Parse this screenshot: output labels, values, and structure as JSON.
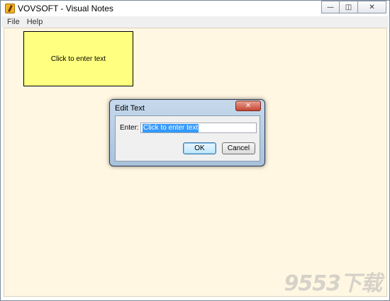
{
  "window": {
    "title": "VOVSOFT - Visual Notes",
    "controls": {
      "minimize": "—",
      "restore": "◫",
      "close": "✕"
    }
  },
  "menu": {
    "items": [
      "File",
      "Help"
    ]
  },
  "note": {
    "text": "Click to enter text",
    "color": "#ffff80"
  },
  "dialog": {
    "title": "Edit Text",
    "close_glyph": "✕",
    "field_label": "Enter:",
    "field_value": "Click to enter text",
    "ok_label": "OK",
    "cancel_label": "Cancel"
  },
  "watermark": {
    "text": "9553下载"
  },
  "colors": {
    "canvas": "#fff7e2",
    "selection": "#3399ff"
  }
}
